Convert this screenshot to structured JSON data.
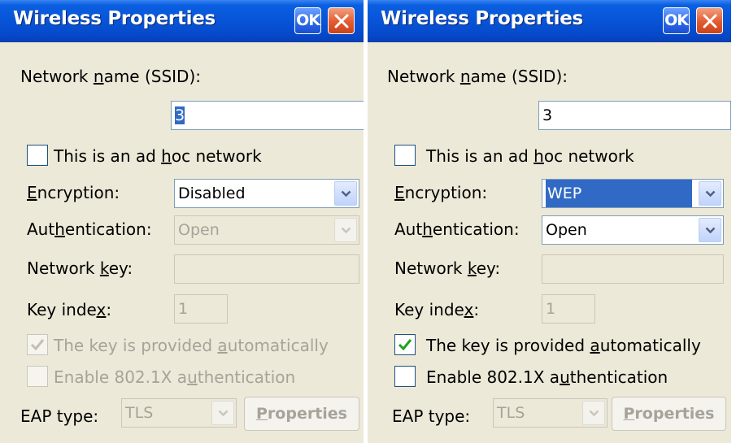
{
  "left": {
    "title": "Wireless Properties",
    "ok_label": "OK",
    "ssid": {
      "label_pre": "Network ",
      "label_u": "n",
      "label_post": "ame (SSID):",
      "value": "3"
    },
    "adhoc": {
      "label_pre": "This is an ad ",
      "label_u": "h",
      "label_post": "oc network",
      "checked": false
    },
    "encryption": {
      "label_pre": "",
      "label_u": "E",
      "label_post": "ncryption:",
      "value": "Disabled"
    },
    "authentication": {
      "label_pre": "Aut",
      "label_u": "h",
      "label_post": "entication:",
      "value": "Open"
    },
    "network_key": {
      "label_pre": "Network ",
      "label_u": "k",
      "label_post": "ey:",
      "value": ""
    },
    "key_index": {
      "label_pre": "Key inde",
      "label_u": "x",
      "label_post": ":",
      "value": "1"
    },
    "auto_key": {
      "label_pre": "The key is provided ",
      "label_u": "a",
      "label_post": "utomatically",
      "checked": true
    },
    "enable_8021x": {
      "label_pre": "Enable 802.1X a",
      "label_u": "u",
      "label_post": "thentication",
      "checked": false
    },
    "eap": {
      "label": "EAP type:",
      "value": "TLS"
    },
    "properties": {
      "label_u": "P",
      "label_post": "roperties"
    }
  },
  "right": {
    "title": "Wireless Properties",
    "ok_label": "OK",
    "ssid": {
      "label_pre": "Network ",
      "label_u": "n",
      "label_post": "ame (SSID):",
      "value": "3"
    },
    "adhoc": {
      "label_pre": "This is an ad ",
      "label_u": "h",
      "label_post": "oc network",
      "checked": false
    },
    "encryption": {
      "label_pre": "",
      "label_u": "E",
      "label_post": "ncryption:",
      "value": "WEP"
    },
    "authentication": {
      "label_pre": "Aut",
      "label_u": "h",
      "label_post": "entication:",
      "value": "Open"
    },
    "network_key": {
      "label_pre": "Network ",
      "label_u": "k",
      "label_post": "ey:",
      "value": ""
    },
    "key_index": {
      "label_pre": "Key inde",
      "label_u": "x",
      "label_post": ":",
      "value": "1"
    },
    "auto_key": {
      "label_pre": "The key is provided ",
      "label_u": "a",
      "label_post": "utomatically",
      "checked": true
    },
    "enable_8021x": {
      "label_pre": "Enable 802.1X a",
      "label_u": "u",
      "label_post": "thentication",
      "checked": false
    },
    "eap": {
      "label": "EAP type:",
      "value": "TLS"
    },
    "properties": {
      "label_u": "P",
      "label_post": "roperties"
    }
  },
  "colors": {
    "title_bar": "#0852d6",
    "dialog_bg": "#ece9d8",
    "selection": "#316ac5",
    "close_button": "#e35a2f",
    "check_enabled": "#21a121",
    "disabled_text": "#a6a39a"
  },
  "icons": {
    "close": "close-icon",
    "dropdown": "chevron-down-icon",
    "check": "checkmark-icon"
  }
}
